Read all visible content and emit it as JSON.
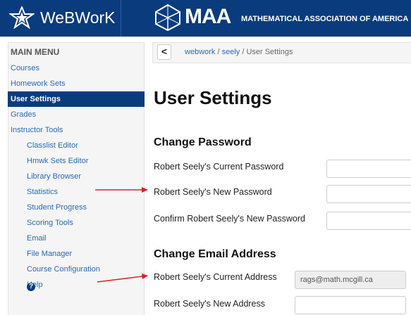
{
  "header": {
    "brand_name": "WeBWorK",
    "maa_word": "MAA",
    "maa_full_name": "MATHEMATICAL ASSOCIATION OF AMERICA"
  },
  "sidebar": {
    "heading": "MAIN MENU",
    "items": [
      {
        "label": "Courses",
        "active": false,
        "indent": false
      },
      {
        "label": "Homework Sets",
        "active": false,
        "indent": false
      },
      {
        "label": "User Settings",
        "active": true,
        "indent": false
      },
      {
        "label": "Grades",
        "active": false,
        "indent": false
      },
      {
        "label": "Instructor Tools",
        "active": false,
        "indent": false
      },
      {
        "label": "Classlist Editor",
        "active": false,
        "indent": true
      },
      {
        "label": "Hmwk Sets Editor",
        "active": false,
        "indent": true
      },
      {
        "label": "Library Browser",
        "active": false,
        "indent": true
      },
      {
        "label": "Statistics",
        "active": false,
        "indent": true
      },
      {
        "label": "Student Progress",
        "active": false,
        "indent": true
      },
      {
        "label": "Scoring Tools",
        "active": false,
        "indent": true
      },
      {
        "label": "Email",
        "active": false,
        "indent": true
      },
      {
        "label": "File Manager",
        "active": false,
        "indent": true
      },
      {
        "label": "Course Configuration",
        "active": false,
        "indent": true
      },
      {
        "label": "Help",
        "active": false,
        "indent": true
      }
    ],
    "help_icon_glyph": "?"
  },
  "breadcrumb": {
    "back_glyph": "<",
    "parts": [
      "webwork",
      "seely",
      "User Settings"
    ],
    "separator": " / "
  },
  "main": {
    "title": "User Settings",
    "password_section": {
      "title": "Change Password",
      "current_label": "Robert Seely's Current Password",
      "current_value": "",
      "new_label": "Robert Seely's New Password",
      "new_value": "",
      "confirm_label": "Confirm Robert Seely's New Password",
      "confirm_value": ""
    },
    "email_section": {
      "title": "Change Email Address",
      "current_label": "Robert Seely's Current Address",
      "current_value": "rags@math.mcgill.ca",
      "new_label": "Robert Seely's New Address",
      "new_value": ""
    }
  },
  "annotations": {
    "arrow_color": "#e02020"
  },
  "colors": {
    "brand_blue": "#0a3c7d",
    "link": "#2a6ab1"
  }
}
